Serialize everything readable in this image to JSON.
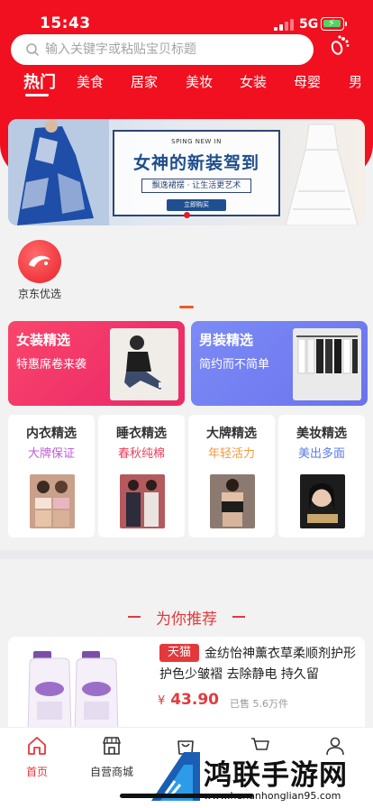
{
  "status_bar": {
    "time": "15:43",
    "network": "5G"
  },
  "search": {
    "placeholder": "输入关键字或粘贴宝贝标题"
  },
  "categories": [
    "热门",
    "美食",
    "居家",
    "美妆",
    "女装",
    "母婴",
    "男"
  ],
  "banner": {
    "small_text": "SPING NEW IN",
    "title": "女神的新装驾到",
    "subtitle": "飘逸裙摆 · 让生活更艺术",
    "button": "立即购买"
  },
  "shortcut": {
    "label": "京东优选"
  },
  "promos": [
    {
      "title": "女装精选",
      "subtitle": "特惠席卷来袭"
    },
    {
      "title": "男装精选",
      "subtitle": "简约而不简单"
    }
  ],
  "mini_cards": [
    {
      "title": "内衣精选",
      "subtitle": "大牌保证",
      "color": "#c05ad9"
    },
    {
      "title": "睡衣精选",
      "subtitle": "春秋纯棉",
      "color": "#e8405c"
    },
    {
      "title": "大牌精选",
      "subtitle": "年轻活力",
      "color": "#f29a3b"
    },
    {
      "title": "美妆精选",
      "subtitle": "美出多面",
      "color": "#5a7be8"
    }
  ],
  "recommend": {
    "heading": "为你推荐",
    "product": {
      "badge": "天猫",
      "title": "金纺怡神薰衣草柔顺剂护形护色少皱褶 去除静电 持久留",
      "currency": "¥",
      "price": "43.90",
      "sold": "已售 5.6万件"
    }
  },
  "tabbar": [
    {
      "label": "首页",
      "icon": "home-icon",
      "active": true
    },
    {
      "label": "自营商城",
      "icon": "store-icon",
      "active": false
    },
    {
      "label": "",
      "icon": "bag-icon",
      "active": false
    },
    {
      "label": "",
      "icon": "cart-icon",
      "active": false
    },
    {
      "label": "",
      "icon": "user-icon",
      "active": false
    }
  ],
  "watermark": {
    "name": "鸿联手游网",
    "url": "www.henanhonglian95.com"
  },
  "colors": {
    "brand_red": "#f0101f",
    "price_red": "#e4393c"
  }
}
